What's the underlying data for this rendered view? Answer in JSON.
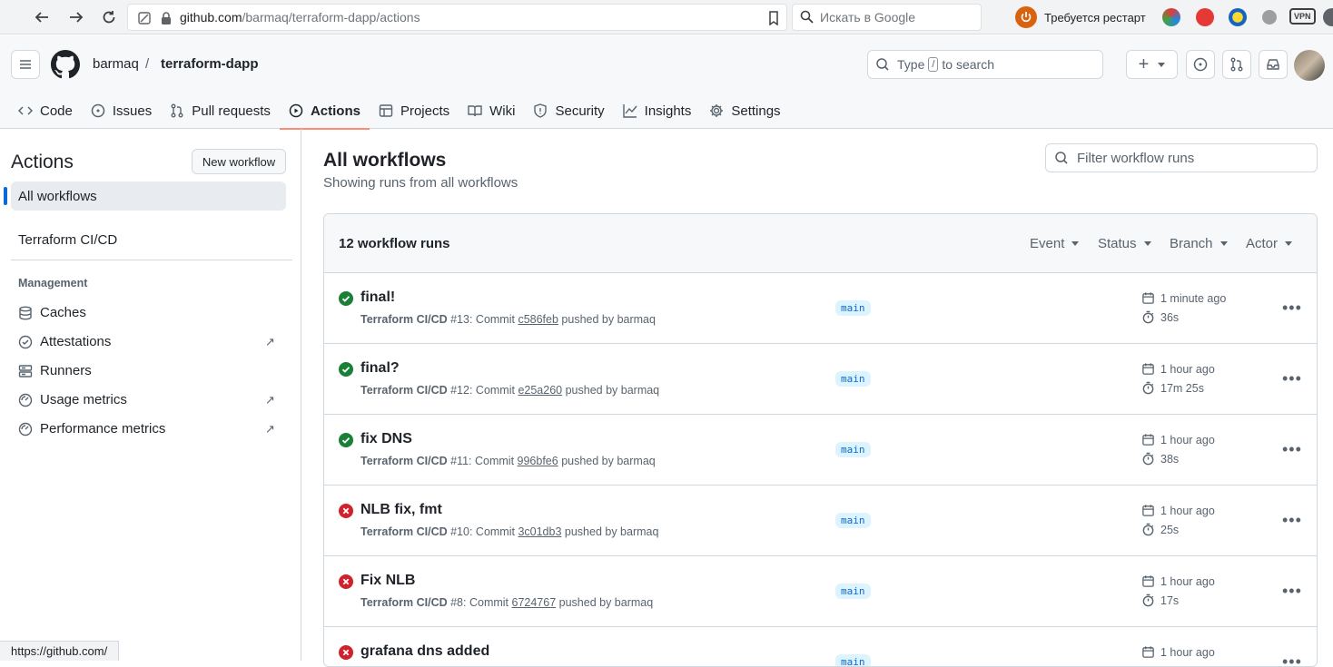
{
  "browser": {
    "url_host": "github.com",
    "url_path": "/barmaq/terraform-dapp/actions",
    "search_placeholder": "Искать в Google",
    "restart_label": "Требуется рестарт",
    "vpn_label": "VPN",
    "status_url": "https://github.com/"
  },
  "header": {
    "owner": "barmaq",
    "separator": "/",
    "repo": "terraform-dapp",
    "search_prefix": "Type",
    "search_key": "/",
    "search_suffix": "to search",
    "plus_label": "+"
  },
  "tabs": [
    {
      "label": "Code",
      "icon": "code-icon"
    },
    {
      "label": "Issues",
      "icon": "issue-icon"
    },
    {
      "label": "Pull requests",
      "icon": "pull-request-icon"
    },
    {
      "label": "Actions",
      "icon": "play-icon",
      "active": true
    },
    {
      "label": "Projects",
      "icon": "table-icon"
    },
    {
      "label": "Wiki",
      "icon": "book-icon"
    },
    {
      "label": "Security",
      "icon": "shield-icon"
    },
    {
      "label": "Insights",
      "icon": "graph-icon"
    },
    {
      "label": "Settings",
      "icon": "gear-icon"
    }
  ],
  "sidebar": {
    "title": "Actions",
    "new_workflow": "New workflow",
    "all_workflows": "All workflows",
    "workflow": "Terraform CI/CD",
    "management_title": "Management",
    "management": [
      {
        "label": "Caches",
        "icon": "database-icon",
        "external": false
      },
      {
        "label": "Attestations",
        "icon": "verified-icon",
        "external": true
      },
      {
        "label": "Runners",
        "icon": "server-icon",
        "external": false
      },
      {
        "label": "Usage metrics",
        "icon": "meter-icon",
        "external": true
      },
      {
        "label": "Performance metrics",
        "icon": "meter-icon",
        "external": true
      }
    ],
    "external_glyph": "↗"
  },
  "main": {
    "title": "All workflows",
    "subtitle": "Showing runs from all workflows",
    "filter_placeholder": "Filter workflow runs",
    "count": "12 workflow runs",
    "filters": [
      "Event",
      "Status",
      "Branch",
      "Actor"
    ],
    "runs": [
      {
        "title": "final!",
        "status": "success",
        "workflow": "Terraform CI/CD",
        "num": "#13",
        "commit_prefix": ": Commit ",
        "sha": "c586feb",
        "by": " pushed by barmaq",
        "branch": "main",
        "ago": "1 minute ago",
        "duration": "36s"
      },
      {
        "title": "final?",
        "status": "success",
        "workflow": "Terraform CI/CD",
        "num": "#12",
        "commit_prefix": ": Commit ",
        "sha": "e25a260",
        "by": " pushed by barmaq",
        "branch": "main",
        "ago": "1 hour ago",
        "duration": "17m 25s"
      },
      {
        "title": "fix DNS",
        "status": "success",
        "workflow": "Terraform CI/CD",
        "num": "#11",
        "commit_prefix": ": Commit ",
        "sha": "996bfe6",
        "by": " pushed by barmaq",
        "branch": "main",
        "ago": "1 hour ago",
        "duration": "38s"
      },
      {
        "title": "NLB fix, fmt",
        "status": "failure",
        "workflow": "Terraform CI/CD",
        "num": "#10",
        "commit_prefix": ": Commit ",
        "sha": "3c01db3",
        "by": " pushed by barmaq",
        "branch": "main",
        "ago": "1 hour ago",
        "duration": "25s"
      },
      {
        "title": "Fix NLB",
        "status": "failure",
        "workflow": "Terraform CI/CD",
        "num": "#8",
        "commit_prefix": ": Commit ",
        "sha": "6724767",
        "by": " pushed by barmaq",
        "branch": "main",
        "ago": "1 hour ago",
        "duration": "17s"
      },
      {
        "title": "grafana dns added",
        "status": "failure",
        "workflow": "",
        "num": "",
        "commit_prefix": "",
        "sha": "",
        "by": "",
        "branch": "main",
        "ago": "1 hour ago",
        "duration": ""
      }
    ]
  },
  "colors": {
    "success": "#1a7f37",
    "failure": "#cf222e",
    "active_tab_underline": "#fd8c73",
    "accent": "#0969da"
  }
}
